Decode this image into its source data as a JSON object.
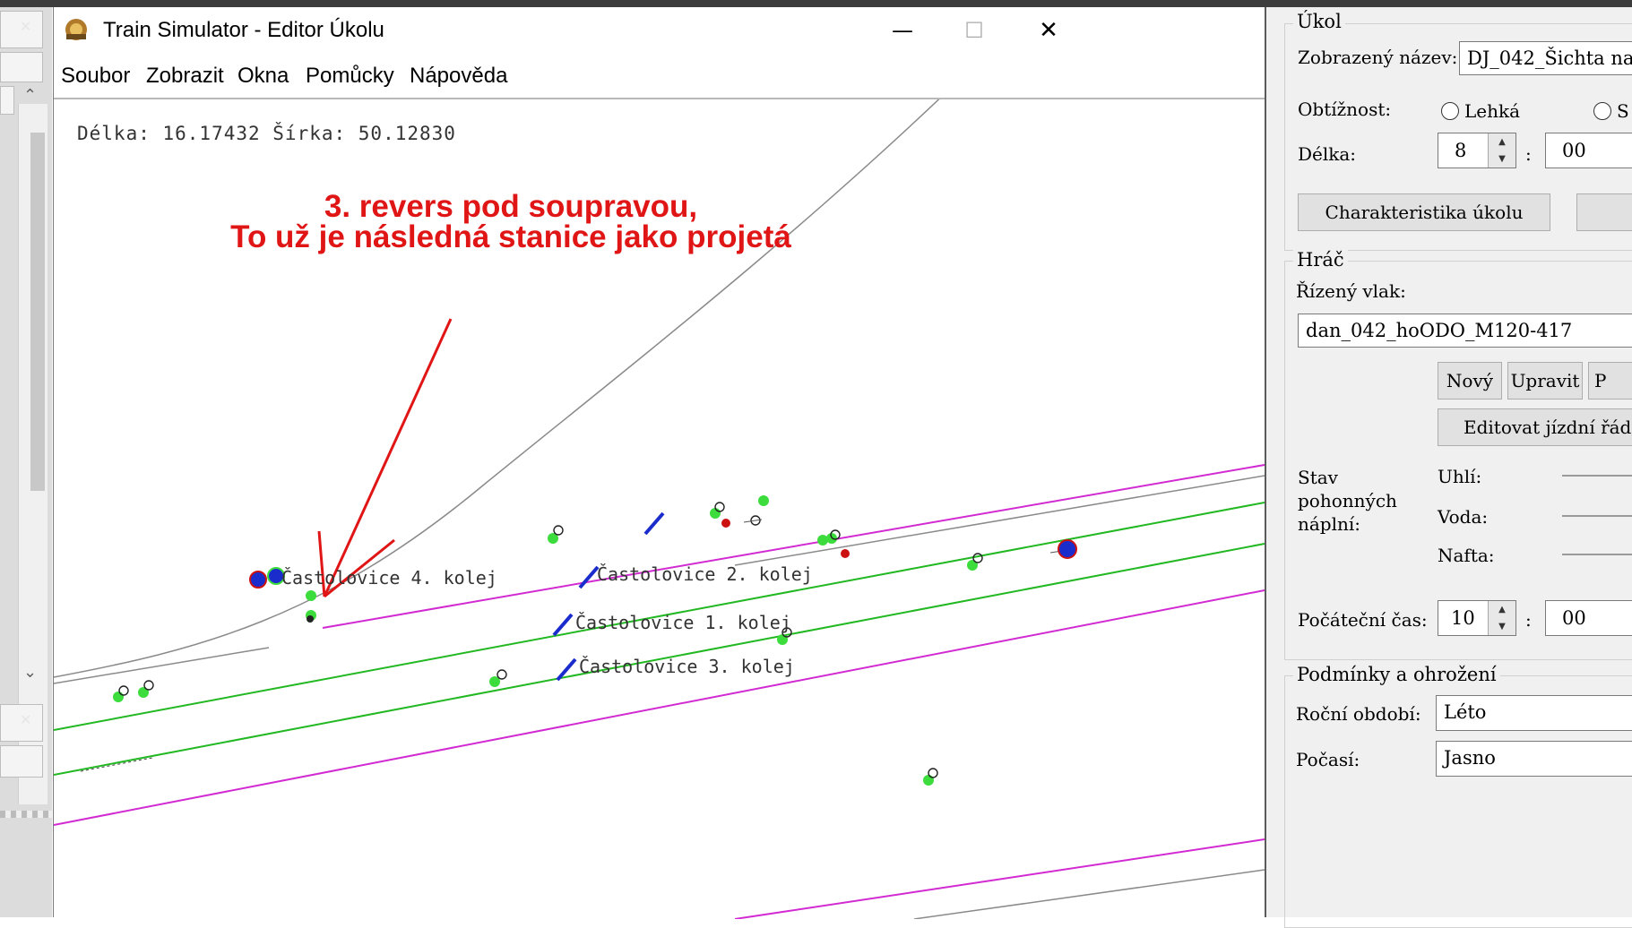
{
  "window": {
    "title": "Train Simulator - Editor Úkolu",
    "minimize": "—",
    "maximize": "☐",
    "close": "✕"
  },
  "menu": [
    "Soubor",
    "Zobrazit",
    "Okna",
    "Pomůcky",
    "Nápověda"
  ],
  "map": {
    "coords": "Délka: 16.17432 Šírka: 50.12830",
    "annotation_line1": "3. revers pod soupravou,",
    "annotation_line2": "To už je následná stanice jako projetá",
    "tracks": [
      {
        "label": "Častolovice 4. kolej"
      },
      {
        "label": "Častolovice  2. kolej"
      },
      {
        "label": "Častolovice 1. kolej"
      },
      {
        "label": "Častolovice 3. kolej"
      }
    ],
    "colors": {
      "green_track": "#22b822",
      "magenta_track": "#d22ad2",
      "gray_track": "#8a8a8a",
      "annotation": "#e01515",
      "platform": "#1a2ccc"
    }
  },
  "panel": {
    "ukol": {
      "legend": "Úkol",
      "name_label": "Zobrazený název:",
      "name_value": "DJ_042_Šichta na",
      "difficulty_label": "Obtížnost:",
      "difficulty_options": [
        "Lehká",
        "S"
      ],
      "length_label": "Délka:",
      "length_hours": "8",
      "length_minutes": "00",
      "time_sep": ":",
      "characteristics_button": "Charakteristika úkolu"
    },
    "hrac": {
      "legend": "Hráč",
      "train_label": "Řízený vlak:",
      "train_value": "dan_042_hoODO_M120-417",
      "new_button": "Nový",
      "edit_button": "Upravit",
      "third_button": "P",
      "timetable_button": "Editovat jízdní řád",
      "fuel_label": "Stav pohonných náplní:",
      "coal_label": "Uhlí:",
      "water_label": "Voda:",
      "diesel_label": "Nafta:",
      "start_time_label": "Počáteční čas:",
      "start_hours": "10",
      "start_minutes": "00",
      "time_sep": ":"
    },
    "podminky": {
      "legend": "Podmínky a ohrožení",
      "season_label": "Roční období:",
      "season_value": "Léto",
      "weather_label": "Počasí:",
      "weather_value": "Jasno"
    }
  }
}
